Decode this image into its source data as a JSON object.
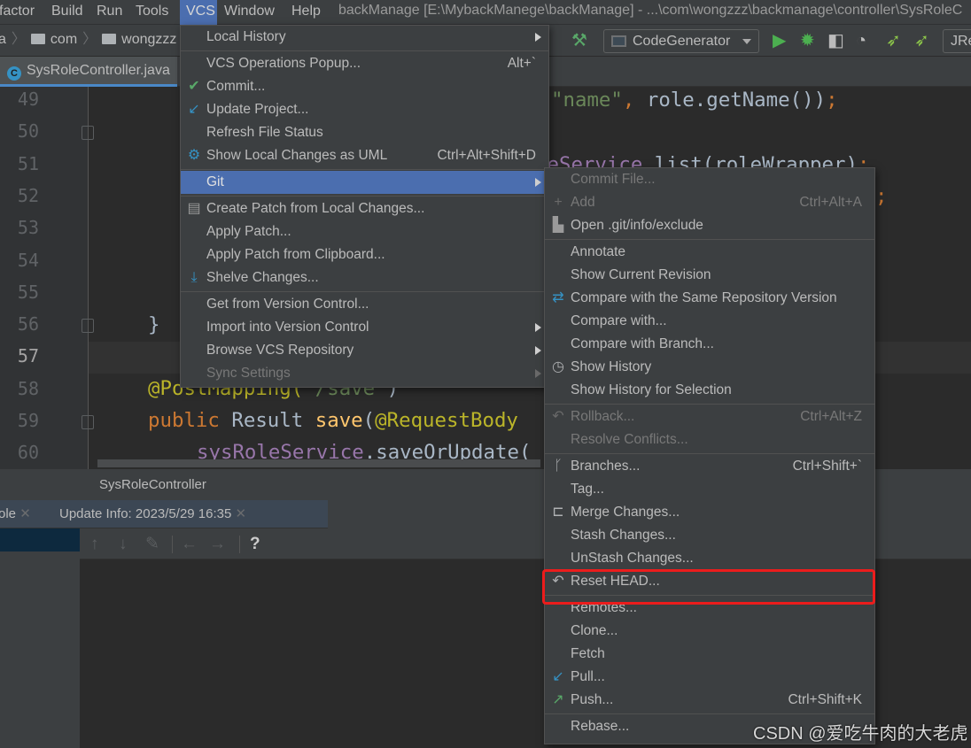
{
  "menubar": {
    "items": [
      "factor",
      "Build",
      "Run",
      "Tools",
      "VCS",
      "Window",
      "Help"
    ],
    "active": "VCS",
    "title": "backManage [E:\\MybackManege\\backManage] - ...\\com\\wongzzz\\backmanage\\controller\\SysRoleC"
  },
  "breadcrumb": [
    "a",
    "com",
    "wongzzz"
  ],
  "toolbar": {
    "run_config": "CodeGenerator",
    "jrebel": "JRe",
    "icons": [
      "hammer-icon",
      "run-icon",
      "debug-icon",
      "coverage-icon",
      "profile-icon",
      "jrebel-run-icon",
      "jrebel-debug-icon"
    ]
  },
  "editor_tab": {
    "label": "SysRoleController.java",
    "icon": "C"
  },
  "editor": {
    "line_numbers": [
      "49",
      "50",
      "51",
      "52",
      "53",
      "54",
      "55",
      "56",
      "57",
      "58",
      "59",
      "60"
    ],
    "current_line": "57",
    "code": {
      "l49": {
        "str": "\"name\"",
        "comma": ",",
        "rest": " role.getName())",
        "semi": ";"
      },
      "l51": {
        "field": "leService",
        "rest": ".list(roleWrapper)",
        "semi": ";"
      },
      "l52": {
        "semi": ";"
      },
      "l56": {
        "brace": "}"
      },
      "l58": {
        "ann": "@PostMapping(",
        "str": "\"/save\"",
        "close": ")"
      },
      "l59": {
        "kw": "public",
        "type": " Result ",
        "fn": "save",
        "paren": "(",
        "ann": "@RequestBody"
      },
      "l60": {
        "field": "sysRoleService",
        "rest": ".saveOrUpdate("
      }
    }
  },
  "navbar": {
    "label": "SysRoleController"
  },
  "tool_tabs": [
    {
      "label": "ole"
    },
    {
      "label": "Update Info: 2023/5/29 16:35"
    }
  ],
  "tool_toolbar": [
    "↑",
    "↓",
    "✎",
    "←",
    "→",
    "?"
  ],
  "vcs_menu": [
    {
      "label": "Local History",
      "submenu": true,
      "sep": true
    },
    {
      "label": "VCS Operations Popup...",
      "shortcut": "Alt+`"
    },
    {
      "label": "Commit...",
      "icon": "✔",
      "icon_color": "#59a869"
    },
    {
      "label": "Update Project...",
      "icon": "↙",
      "icon_color": "#3592c4"
    },
    {
      "label": "Refresh File Status"
    },
    {
      "label": "Show Local Changes as UML",
      "shortcut": "Ctrl+Alt+Shift+D",
      "icon": "⚙",
      "icon_color": "#3592c4",
      "sep": true
    },
    {
      "label": "Git",
      "submenu": true,
      "selected": true,
      "sep": true
    },
    {
      "label": "Create Patch from Local Changes...",
      "icon": "▤",
      "icon_color": "#9a9a9a"
    },
    {
      "label": "Apply Patch..."
    },
    {
      "label": "Apply Patch from Clipboard..."
    },
    {
      "label": "Shelve Changes...",
      "icon": "⤓",
      "icon_color": "#3592c4",
      "sep": true
    },
    {
      "label": "Get from Version Control..."
    },
    {
      "label": "Import into Version Control",
      "submenu": true
    },
    {
      "label": "Browse VCS Repository",
      "submenu": true
    },
    {
      "label": "Sync Settings",
      "submenu": true,
      "disabled": true
    }
  ],
  "git_menu": [
    {
      "label": "Commit File...",
      "disabled": true
    },
    {
      "label": "Add",
      "shortcut": "Ctrl+Alt+A",
      "disabled": true,
      "icon": "+",
      "icon_color": "#6a6a6a"
    },
    {
      "label": "Open .git/info/exclude",
      "icon": "▙",
      "icon_color": "#9a9a9a",
      "sep": true
    },
    {
      "label": "Annotate"
    },
    {
      "label": "Show Current Revision"
    },
    {
      "label": "Compare with the Same Repository Version",
      "icon": "⇄",
      "icon_color": "#3592c4"
    },
    {
      "label": "Compare with..."
    },
    {
      "label": "Compare with Branch..."
    },
    {
      "label": "Show History",
      "icon": "◷",
      "icon_color": "#afb1b3"
    },
    {
      "label": "Show History for Selection",
      "sep": true
    },
    {
      "label": "Rollback...",
      "shortcut": "Ctrl+Alt+Z",
      "disabled": true,
      "icon": "↶",
      "icon_color": "#6a6a6a"
    },
    {
      "label": "Resolve Conflicts...",
      "disabled": true,
      "sep": true
    },
    {
      "label": "Branches...",
      "shortcut": "Ctrl+Shift+`",
      "icon": "ᚴ",
      "icon_color": "#afb1b3"
    },
    {
      "label": "Tag..."
    },
    {
      "label": "Merge Changes...",
      "icon": "⊏",
      "icon_color": "#afb1b3"
    },
    {
      "label": "Stash Changes..."
    },
    {
      "label": "UnStash Changes..."
    },
    {
      "label": "Reset HEAD...",
      "icon": "↶",
      "icon_color": "#afb1b3",
      "highlighted": true,
      "sep": true
    },
    {
      "label": "Remotes..."
    },
    {
      "label": "Clone..."
    },
    {
      "label": "Fetch"
    },
    {
      "label": "Pull...",
      "icon": "↙",
      "icon_color": "#3592c4"
    },
    {
      "label": "Push...",
      "shortcut": "Ctrl+Shift+K",
      "icon": "↗",
      "icon_color": "#59a869",
      "sep": true
    },
    {
      "label": "Rebase..."
    }
  ],
  "highlight_color": "#ec1c1c",
  "watermark": "CSDN @爱吃牛肉的大老虎"
}
